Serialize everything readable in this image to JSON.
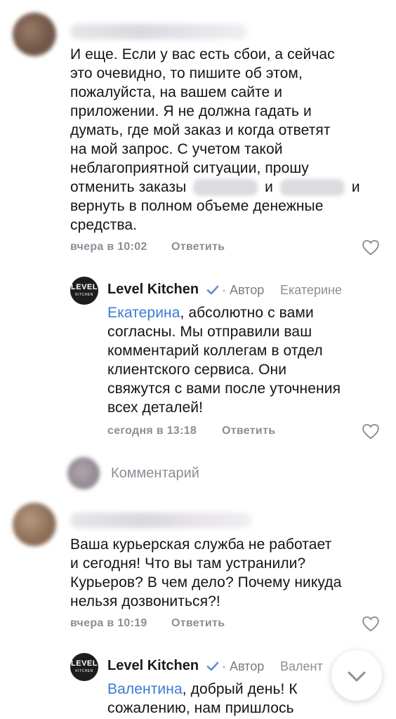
{
  "comments": [
    {
      "text_lines": [
        "И еще. Если у вас есть сбои, а сейчас",
        "это очевидно, то пишите об этом,",
        "пожалуйста, на вашем сайте и",
        "приложении. Я не должна гадать и",
        "думать, где мой заказ и когда ответят",
        "на мой запрос. С учетом такой",
        "неблагоприятной ситуации, прошу"
      ],
      "line8_a": "отменить заказы",
      "line8_b": "и",
      "line8_c": "и",
      "line9": "вернуть в полном объеме денежные",
      "line10": "средства.",
      "time": "вчера в 10:02",
      "reply_label": "Ответить",
      "reply": {
        "author": "Level Kitchen",
        "role": "· Автор",
        "addressee": "Екатерине",
        "mention": "Екатерина",
        "first_line_rest": ", абсолютно с вами",
        "lines": [
          "согласны. Мы отправили ваш",
          "комментарий коллегам в отдел",
          "клиентского сервиса. Они",
          "свяжутся с вами после уточнения",
          "всех деталей!"
        ],
        "time": "сегодня в 13:18",
        "reply_label": "Ответить"
      }
    },
    {
      "text_lines": [
        "Ваша курьерская служба не работает",
        "и сегодня! Что вы там устранили?",
        "Курьеров? В чем дело? Почему никуда",
        "нельзя дозвониться?!"
      ],
      "time": "вчера в 10:19",
      "reply_label": "Ответить",
      "reply": {
        "author": "Level Kitchen",
        "role": "· Автор",
        "addressee": "Валент",
        "mention": "Валентина",
        "first_line_rest": ", добрый день! К",
        "partial_line": "сожалению, нам пришлось"
      }
    }
  ],
  "comment_input": {
    "placeholder": "Комментарий"
  },
  "logo": {
    "line1": "LEVEL",
    "line2": "KITCHEN"
  },
  "icons": {
    "like": "heart-outline-icon",
    "verified": "verified-check-icon",
    "scroll": "chevron-down-icon"
  },
  "colors": {
    "link": "#3a7bd5",
    "meta": "#8a8f96",
    "verified": "#5b8fd6"
  }
}
